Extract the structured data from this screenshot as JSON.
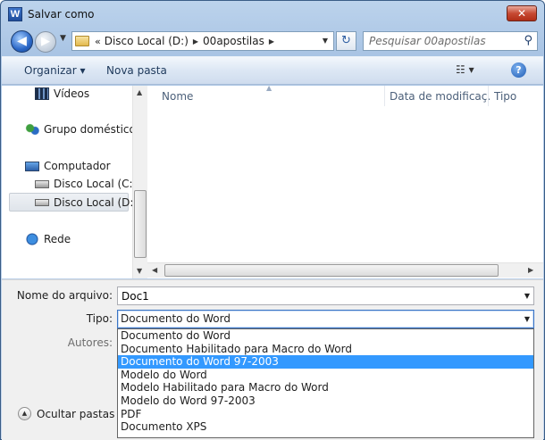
{
  "window": {
    "title": "Salvar como",
    "app_icon_letter": "W",
    "close_glyph": "✕"
  },
  "address": {
    "more_glyph": "«",
    "crumbs": [
      "Disco Local (D:)",
      "00apostilas"
    ],
    "separator": "▶",
    "search_placeholder": "Pesquisar 00apostilas"
  },
  "toolbar": {
    "organize_label": "Organizar ▾",
    "new_folder_label": "Nova pasta",
    "views_label": "☷ ▾",
    "help_glyph": "?"
  },
  "nav": {
    "items": [
      {
        "label": "Vídeos",
        "icon": "videos-icon"
      },
      {
        "label": "Grupo doméstico",
        "icon": "homegroup-icon"
      },
      {
        "label": "Computador",
        "icon": "computer-icon"
      },
      {
        "label": "Disco Local (C:)",
        "icon": "disk-c-icon"
      },
      {
        "label": "Disco Local (D:)",
        "icon": "disk-d-icon"
      },
      {
        "label": "Rede",
        "icon": "network-icon"
      }
    ],
    "selected": "Disco Local (D:)"
  },
  "file_list": {
    "columns": [
      "Nome",
      "Data de modificaç...",
      "Tipo"
    ]
  },
  "form": {
    "filename_label": "Nome do arquivo:",
    "filename_value": "Doc1",
    "type_label": "Tipo:",
    "type_value": "Documento do Word",
    "authors_label": "Autores:",
    "type_options": [
      "Documento do Word",
      "Documento Habilitado para Macro do Word",
      "Documento do Word 97-2003",
      "Modelo do Word",
      "Modelo Habilitado para Macro do Word",
      "Modelo do Word 97-2003",
      "PDF",
      "Documento XPS"
    ],
    "highlighted_option": "Documento do Word 97-2003",
    "hide_folders_label": "Ocultar pastas"
  },
  "colors": {
    "selection": "#3399ff",
    "frame": "#a9c4e4"
  }
}
